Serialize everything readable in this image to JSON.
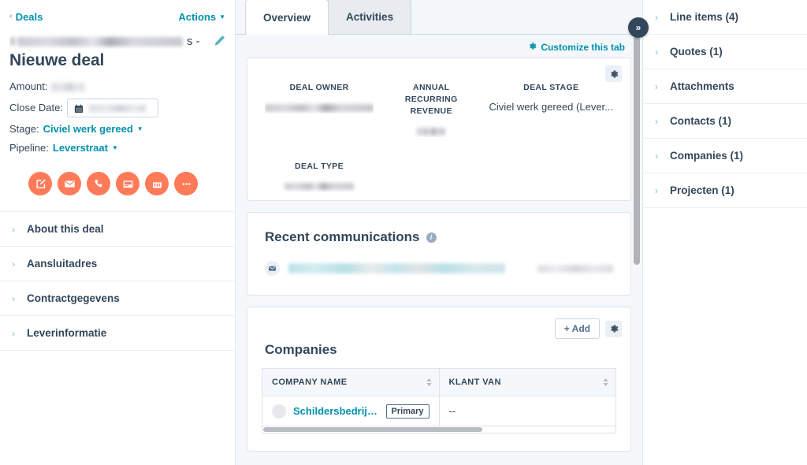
{
  "left_sidebar": {
    "back_link": "Deals",
    "actions_label": "Actions",
    "company_suffix": "s -",
    "deal_name": "Nieuwe deal",
    "fields": {
      "amount_label": "Amount:",
      "close_date_label": "Close Date:",
      "stage_label": "Stage:",
      "stage_value": "Civiel werk gereed",
      "pipeline_label": "Pipeline:",
      "pipeline_value": "Leverstraat"
    },
    "quick_actions": [
      {
        "name": "note-icon",
        "title": "Note"
      },
      {
        "name": "email-icon",
        "title": "Email"
      },
      {
        "name": "call-icon",
        "title": "Call"
      },
      {
        "name": "log-icon",
        "title": "Log"
      },
      {
        "name": "meeting-icon",
        "title": "Meeting"
      },
      {
        "name": "more-icon",
        "title": "More"
      }
    ],
    "accordions": [
      {
        "label": "About this deal"
      },
      {
        "label": "Aansluitadres"
      },
      {
        "label": "Contractgegevens"
      },
      {
        "label": "Leverinformatie"
      }
    ]
  },
  "center": {
    "tabs": [
      {
        "label": "Overview",
        "active": true
      },
      {
        "label": "Activities",
        "active": false
      }
    ],
    "customize_link": "Customize this tab",
    "overview_card": {
      "properties": [
        {
          "label": "DEAL OWNER",
          "value": "",
          "redacted": true
        },
        {
          "label": "ANNUAL RECURRING REVENUE",
          "value": "",
          "redacted": true
        },
        {
          "label": "DEAL STAGE",
          "value": "Civiel werk gereed (Lever...",
          "redacted": false
        },
        {
          "label": "DEAL TYPE",
          "value": "",
          "redacted": true
        }
      ]
    },
    "recent_communications": {
      "title": "Recent communications",
      "rows": [
        {
          "icon": "email-icon",
          "subject": "",
          "date": "",
          "redacted": true
        }
      ]
    },
    "companies_card": {
      "title": "Companies",
      "add_label": "+ Add",
      "columns": [
        "COMPANY NAME",
        "KLANT VAN"
      ],
      "rows": [
        {
          "company_name": "Schildersbedrijf...",
          "tag": "Primary",
          "klant_van": "--"
        }
      ]
    }
  },
  "right_sidebar": {
    "collapse_label": "»",
    "items": [
      {
        "label": "Line items (4)"
      },
      {
        "label": "Quotes (1)"
      },
      {
        "label": "Attachments"
      },
      {
        "label": "Contacts (1)"
      },
      {
        "label": "Companies (1)"
      },
      {
        "label": "Projecten (1)"
      }
    ]
  },
  "colors": {
    "accent_teal": "#0091ae",
    "orange": "#ff7a59",
    "text": "#33475b",
    "bg": "#f5f8fa",
    "navy": "#33475b"
  }
}
